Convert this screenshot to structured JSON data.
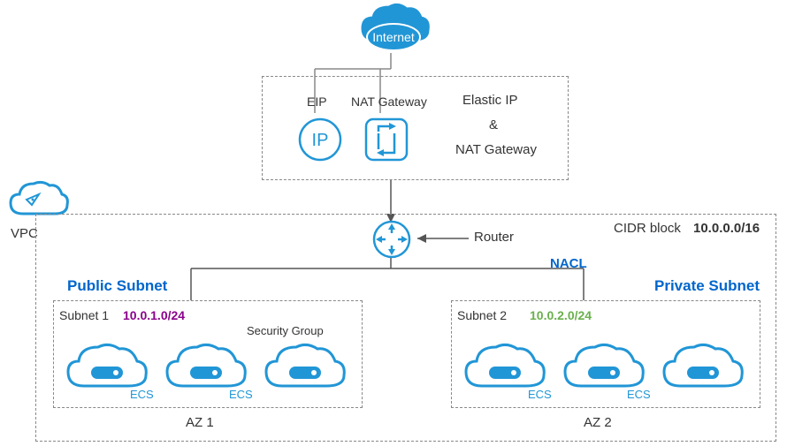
{
  "internet": {
    "label": "Internet"
  },
  "gateway_box": {
    "eip_label": "EIP",
    "nat_label": "NAT Gateway",
    "ip_text": "IP",
    "side_text1": "Elastic IP",
    "side_text2": "&",
    "side_text3": "NAT Gateway"
  },
  "vpc": {
    "label": "VPC",
    "cidr_label": "CIDR block",
    "cidr_value": "10.0.0.0/16",
    "router_label": "Router",
    "nacl_label": "NACL"
  },
  "public_subnet": {
    "title": "Public Subnet",
    "subnet_label": "Subnet 1",
    "cidr": "10.0.1.0/24",
    "sg_label": "Security Group",
    "az_label": "AZ 1",
    "ecs": {
      "label": "ECS"
    }
  },
  "private_subnet": {
    "title": "Private Subnet",
    "subnet_label": "Subnet 2",
    "cidr": "10.0.2.0/24",
    "az_label": "AZ 2",
    "ecs": {
      "label": "ECS"
    }
  }
}
